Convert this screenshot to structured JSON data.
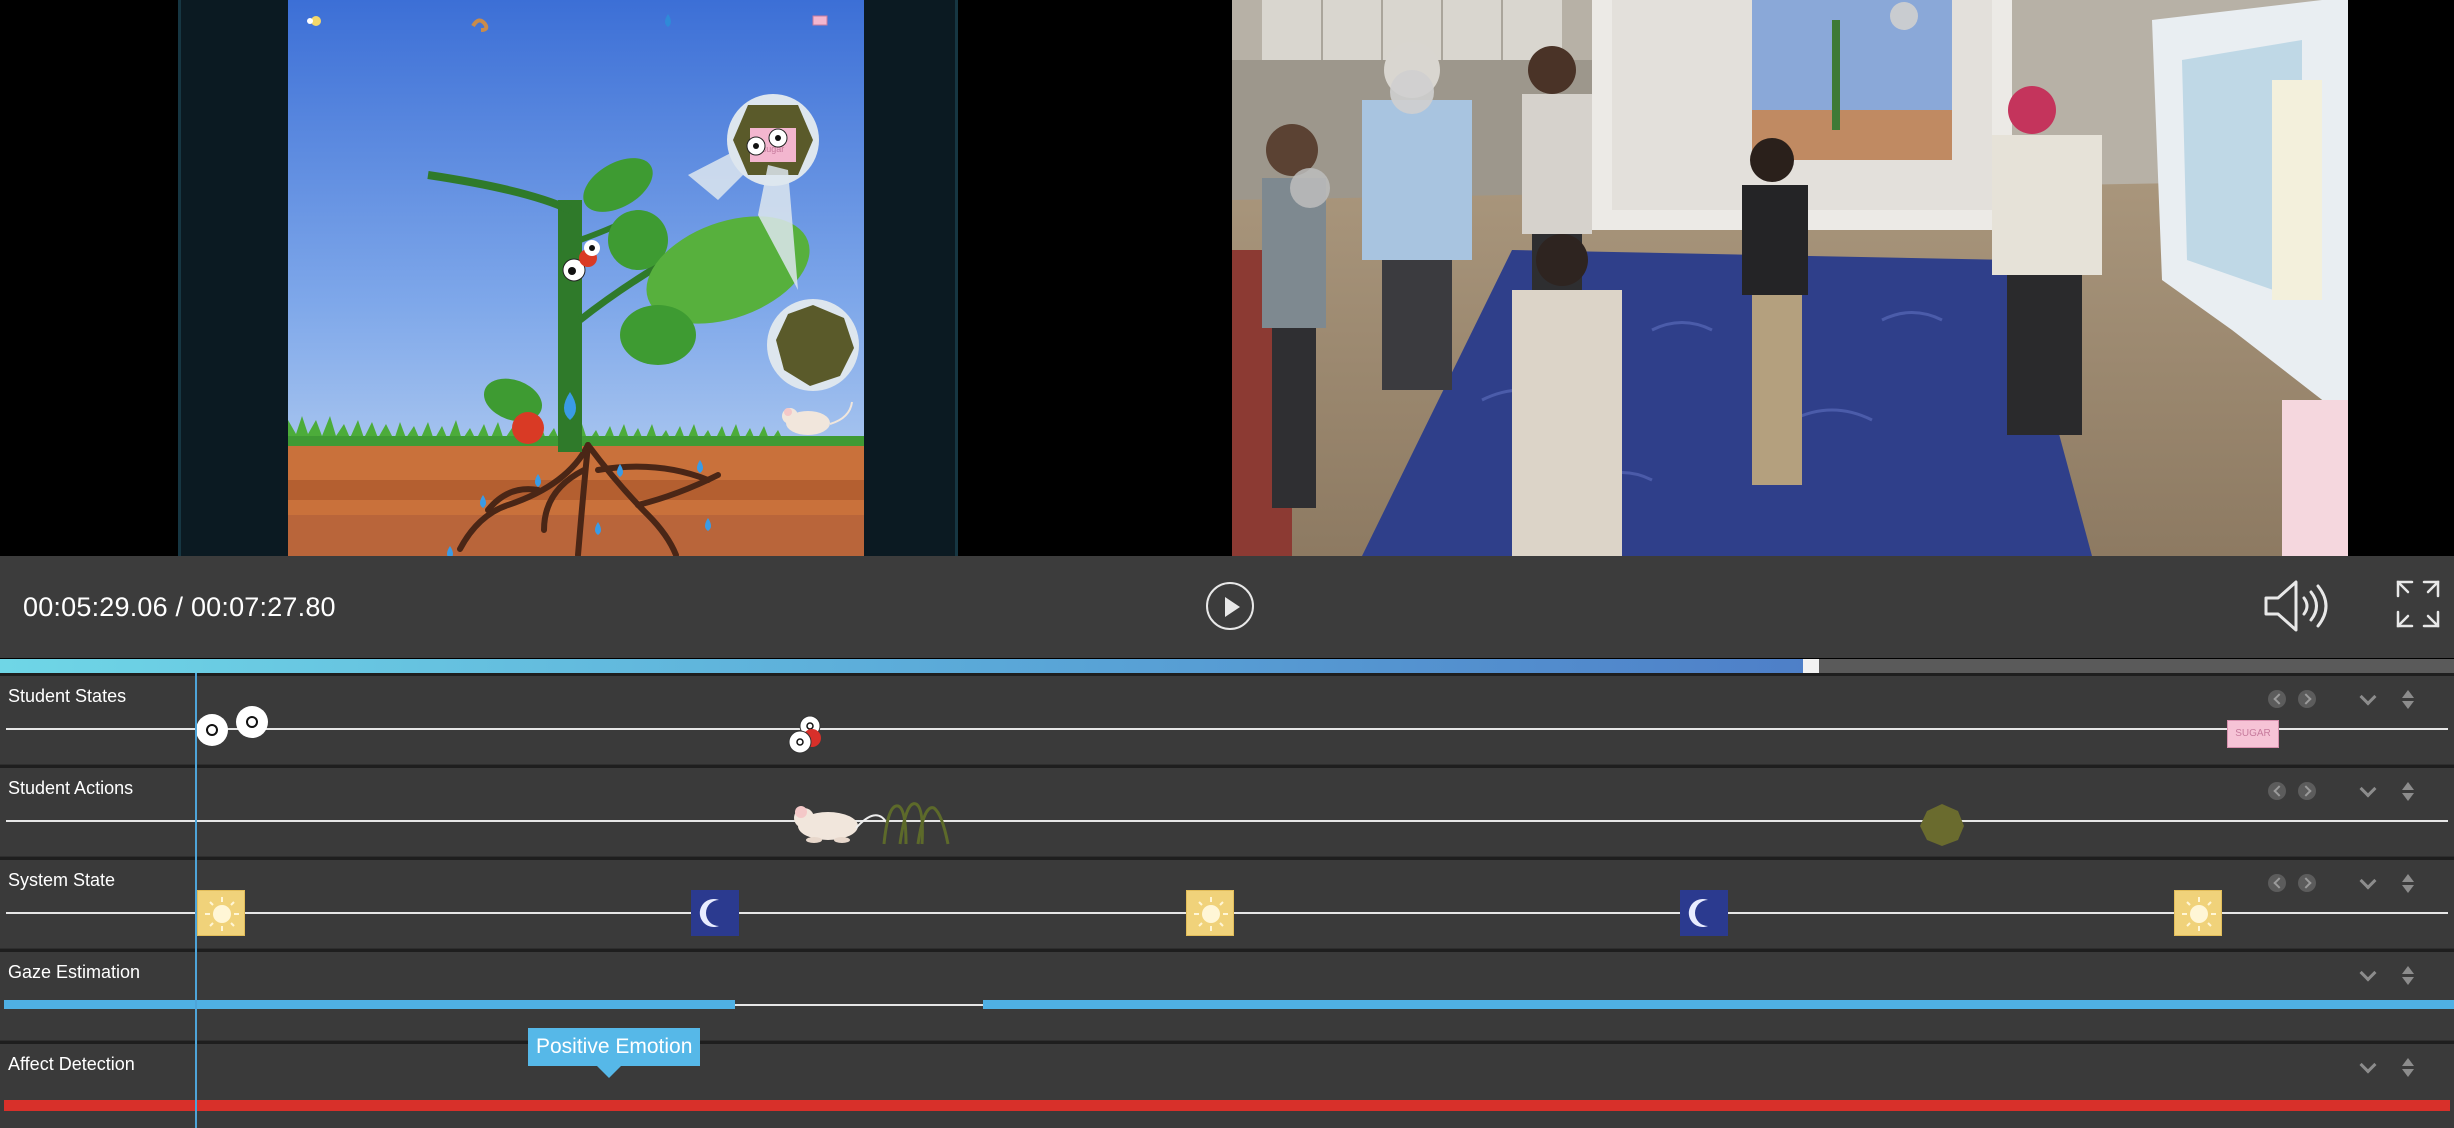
{
  "player": {
    "time_display": "00:05:29.06 / 00:07:27.80",
    "play_icon": "play-icon",
    "volume_icon": "volume-icon",
    "fullscreen_icon": "fullscreen-icon",
    "progress_fraction": 0.7356
  },
  "simulation": {
    "sugar_label": "sugar"
  },
  "tracks": [
    {
      "label": "Student States"
    },
    {
      "label": "Student Actions"
    },
    {
      "label": "System State"
    },
    {
      "label": "Gaze Estimation"
    },
    {
      "label": "Affect Detection"
    }
  ],
  "student_states": {
    "sugar_marker_label": "SUGAR"
  },
  "affect": {
    "tooltip": "Positive Emotion"
  },
  "colors": {
    "progress_start": "#6fd6e6",
    "progress_end": "#4e7fc8",
    "gaze_bar": "#4fb0e4",
    "affect_bar": "#d8302a",
    "day_marker": "#f0d27a",
    "night_marker": "#2b3a8f",
    "playhead": "#4ea4d8"
  }
}
